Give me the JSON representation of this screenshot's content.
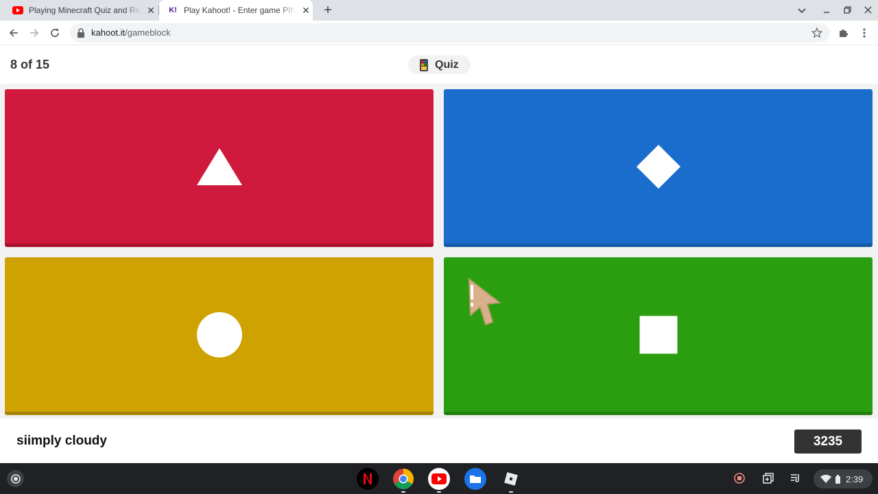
{
  "browser": {
    "tabs": [
      {
        "title": "Playing Minecraft Quiz and Riddles",
        "favicon": "youtube-icon",
        "active": false
      },
      {
        "title": "Play Kahoot! - Enter game PIN here",
        "favicon": "kahoot-icon",
        "favicon_text": "K!",
        "active": true
      }
    ],
    "url_host": "kahoot.it",
    "url_path": "/gameblock"
  },
  "game": {
    "counter": "8 of 15",
    "mode_label": "Quiz",
    "answers": [
      {
        "shape": "triangle-icon",
        "color": "#d01a3d"
      },
      {
        "shape": "diamond-icon",
        "color": "#1a6dcc"
      },
      {
        "shape": "circle-icon",
        "color": "#cea200"
      },
      {
        "shape": "square-icon",
        "color": "#2b9e10"
      }
    ],
    "nickname": "siimply cloudy",
    "score": "3235"
  },
  "shelf": {
    "apps": [
      "netflix-icon",
      "chrome-icon",
      "youtube-icon",
      "files-icon",
      "roblox-icon"
    ],
    "clock": "2:39"
  }
}
